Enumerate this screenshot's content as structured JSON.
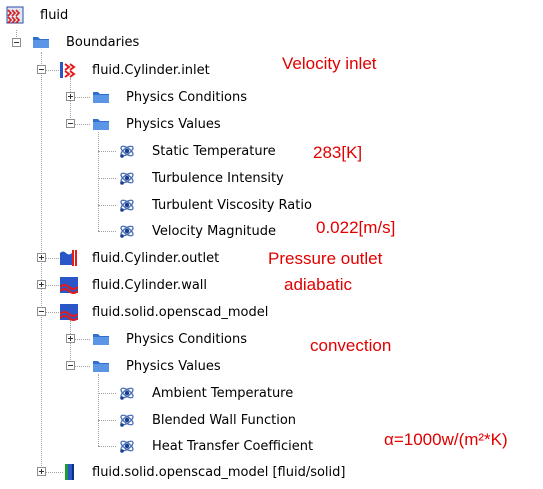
{
  "tree": {
    "root": "fluid",
    "boundaries": "Boundaries",
    "inlet": {
      "label": "fluid.Cylinder.inlet",
      "physics_conditions": "Physics Conditions",
      "physics_values": "Physics Values",
      "values": [
        "Static Temperature",
        "Turbulence Intensity",
        "Turbulent Viscosity Ratio",
        "Velocity Magnitude"
      ]
    },
    "outlet": "fluid.Cylinder.outlet",
    "wall": "fluid.Cylinder.wall",
    "solid_model": {
      "label": "fluid.solid.openscad_model",
      "physics_conditions": "Physics Conditions",
      "physics_values": "Physics Values",
      "values": [
        "Ambient Temperature",
        "Blended Wall Function",
        "Heat Transfer Coefficient"
      ]
    },
    "interface": "fluid.solid.openscad_model [fluid/solid]"
  },
  "annotations": {
    "velocity_inlet": "Velocity inlet",
    "temperature": "283[K]",
    "velocity": "0.022[m/s]",
    "pressure_outlet": "Pressure outlet",
    "adiabatic": "adiabatic",
    "convection": "convection",
    "htc": "α=1000w/(m²*K)"
  },
  "colors": {
    "annotation": "#e00000",
    "folder": "#3b78d8"
  }
}
